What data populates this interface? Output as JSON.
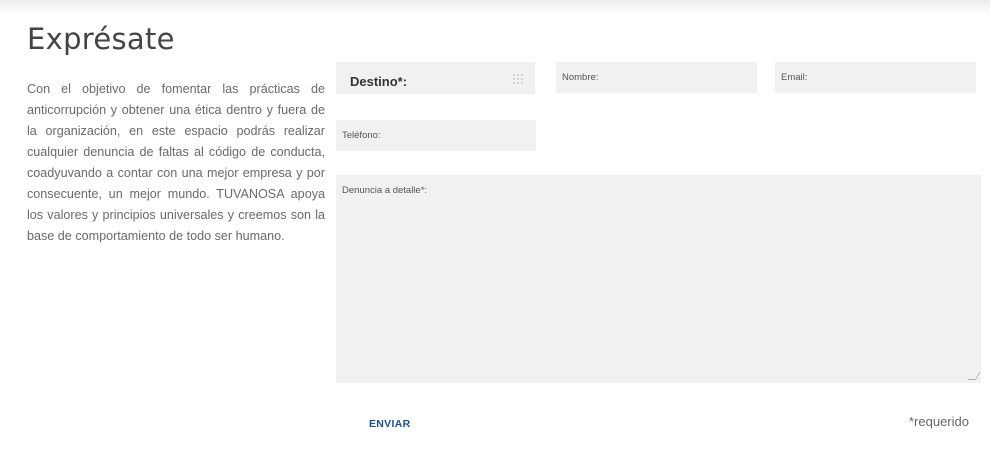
{
  "title": "Exprésate",
  "intro": "Con el objetivo de fomentar las prácticas de anticorrupción y obtener una ética dentro y fuera de la organización, en este espacio podrás realizar cualquier denuncia de faltas al código de conducta, coadyuvando a contar con una mejor empresa y por consecuente, un mejor mundo. TUVANOSA apoya los valores y principios universales y creemos son la base de comportamiento de todo ser humano.",
  "form": {
    "destino_label": "Destino*:",
    "nombre_label": "Nombre:",
    "email_label": "Email:",
    "telefono_label": "Teléfono:",
    "denuncia_label": "Denuncia a detalle*:",
    "submit_label": "ENVIAR",
    "required_note": "*requerido"
  },
  "colors": {
    "field_bg": "#f1f1f1",
    "button_text": "#1f4e8f"
  }
}
